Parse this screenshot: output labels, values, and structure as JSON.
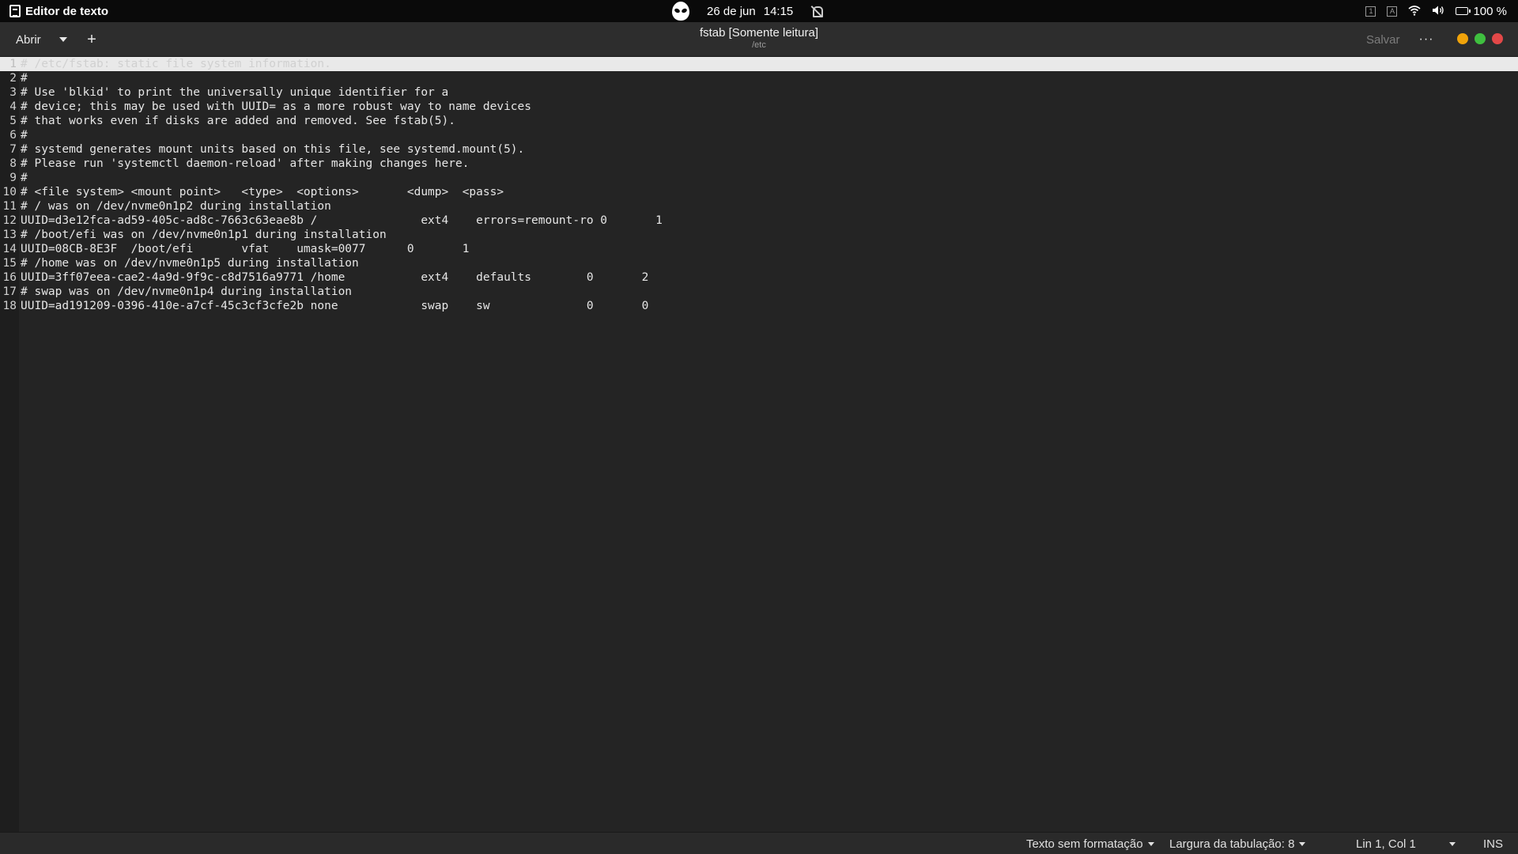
{
  "topbar": {
    "app_name": "Editor de texto",
    "date": "26 de jun",
    "time": "14:15",
    "tray_box1": "1",
    "tray_box2": "A",
    "battery": "100 %"
  },
  "headerbar": {
    "open_label": "Abrir",
    "title": "fstab [Somente leitura]",
    "subtitle": "/etc",
    "save_label": "Salvar",
    "more_label": "···"
  },
  "editor": {
    "lines": [
      {
        "num": "1",
        "text": "# /etc/fstab: static file system information."
      },
      {
        "num": "2",
        "text": "#"
      },
      {
        "num": "3",
        "text": "# Use 'blkid' to print the universally unique identifier for a"
      },
      {
        "num": "4",
        "text": "# device; this may be used with UUID= as a more robust way to name devices"
      },
      {
        "num": "5",
        "text": "# that works even if disks are added and removed. See fstab(5)."
      },
      {
        "num": "6",
        "text": "#"
      },
      {
        "num": "7",
        "text": "# systemd generates mount units based on this file, see systemd.mount(5)."
      },
      {
        "num": "8",
        "text": "# Please run 'systemctl daemon-reload' after making changes here."
      },
      {
        "num": "9",
        "text": "#"
      },
      {
        "num": "10",
        "text": "# <file system> <mount point>   <type>  <options>       <dump>  <pass>"
      },
      {
        "num": "11",
        "text": "# / was on /dev/nvme0n1p2 during installation"
      },
      {
        "num": "12",
        "text": "UUID=d3e12fca-ad59-405c-ad8c-7663c63eae8b /               ext4    errors=remount-ro 0       1"
      },
      {
        "num": "13",
        "text": "# /boot/efi was on /dev/nvme0n1p1 during installation"
      },
      {
        "num": "14",
        "text": "UUID=08CB-8E3F  /boot/efi       vfat    umask=0077      0       1"
      },
      {
        "num": "15",
        "text": "# /home was on /dev/nvme0n1p5 during installation"
      },
      {
        "num": "16",
        "text": "UUID=3ff07eea-cae2-4a9d-9f9c-c8d7516a9771 /home           ext4    defaults        0       2"
      },
      {
        "num": "17",
        "text": "# swap was on /dev/nvme0n1p4 during installation"
      },
      {
        "num": "18",
        "text": "UUID=ad191209-0396-410e-a7cf-45c3cf3cfe2b none            swap    sw              0       0"
      }
    ]
  },
  "statusbar": {
    "syntax": "Texto sem formatação",
    "tab_width": "Largura da tabulação: 8",
    "cursor": "Lin 1, Col 1",
    "mode": "INS"
  },
  "colors": {
    "minimize": "#f0a30a",
    "maximize": "#3fbf3f",
    "close": "#e34848",
    "editor_bg": "#242424"
  }
}
